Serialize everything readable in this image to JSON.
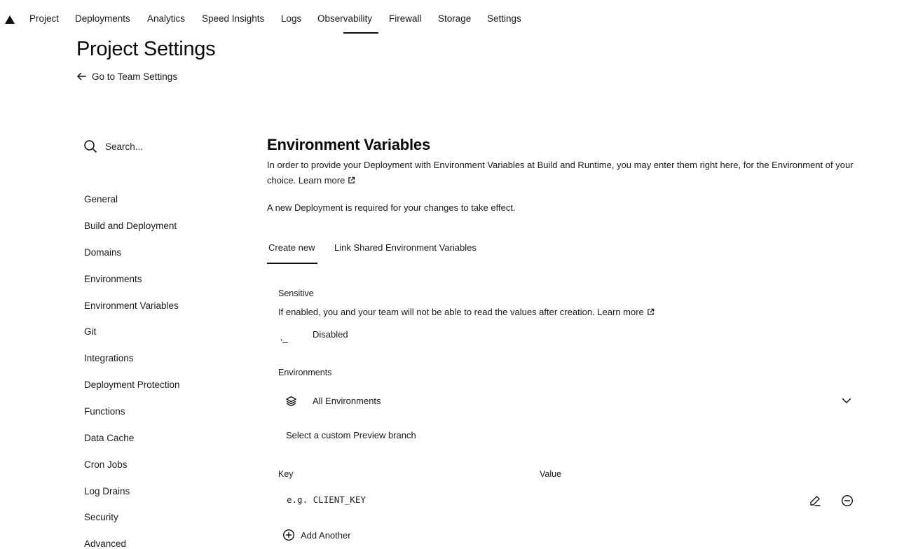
{
  "nav": {
    "items": [
      "Project",
      "Deployments",
      "Analytics",
      "Speed Insights",
      "Logs",
      "Observability",
      "Firewall",
      "Storage",
      "Settings"
    ],
    "active": "Observability"
  },
  "header": {
    "title": "Project Settings",
    "back_link": "Go to Team Settings"
  },
  "sidebar": {
    "search_placeholder": "Search...",
    "items": [
      "General",
      "Build and Deployment",
      "Domains",
      "Environments",
      "Environment Variables",
      "Git",
      "Integrations",
      "Deployment Protection",
      "Functions",
      "Data Cache",
      "Cron Jobs",
      "Log Drains",
      "Security",
      "Advanced"
    ]
  },
  "main": {
    "title": "Environment Variables",
    "description": "In order to provide your Deployment with Environment Variables at Build and Runtime, you may enter them right here, for the Environment of your choice.",
    "learn_more": "Learn more",
    "note": "A new Deployment is required for your changes to take effect.",
    "tabs": [
      "Create new",
      "Link Shared Environment Variables"
    ],
    "sensitive": {
      "label": "Sensitive",
      "description": "If enabled, you and your team will not be able to read the values after creation.",
      "learn_more": "Learn more",
      "state": "Disabled"
    },
    "environments": {
      "label": "Environments",
      "selected": "All Environments",
      "custom_branch": "Select a custom Preview branch"
    },
    "key_label": "Key",
    "value_label": "Value",
    "key_placeholder": "e.g. CLIENT_KEY",
    "add_another": "Add Another"
  },
  "icons": {
    "logo": "triangle-logo-icon",
    "back": "arrow-left-icon",
    "search": "search-icon",
    "external": "external-link-icon",
    "layers": "layers-icon",
    "chevron": "chevron-down-icon",
    "edit": "pencil-icon",
    "remove": "minus-circle-icon",
    "add": "plus-circle-icon"
  },
  "colors": {
    "text": "#111111",
    "background": "#ffffff"
  }
}
